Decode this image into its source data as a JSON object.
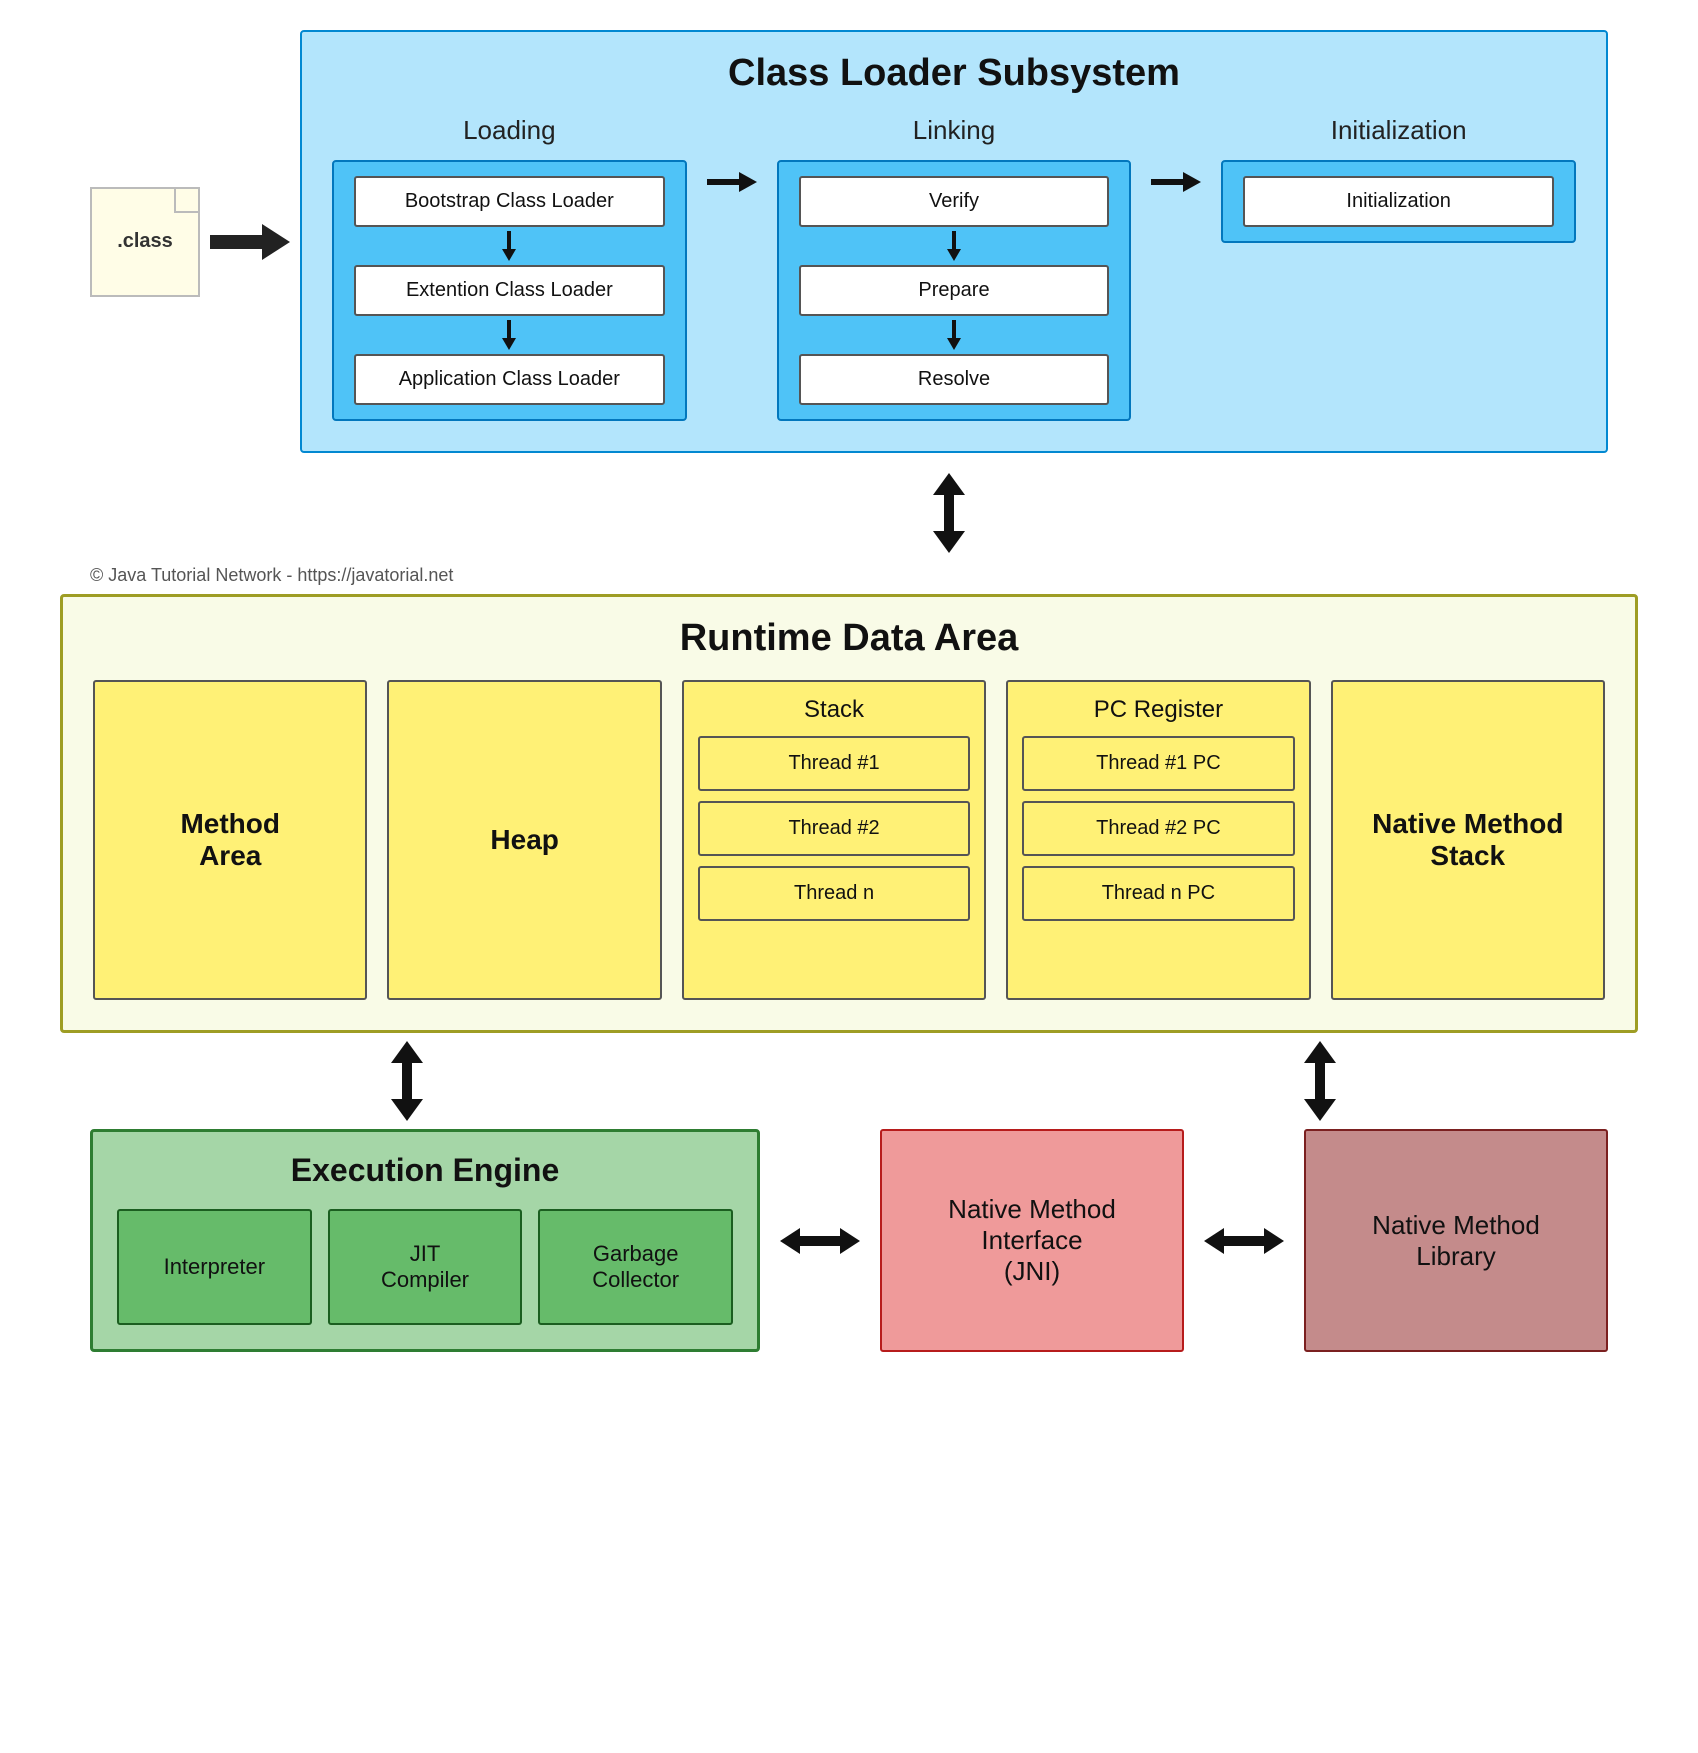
{
  "classFile": {
    "label": ".class"
  },
  "classLoaderSubsystem": {
    "title": "Class Loader Subsystem",
    "phases": {
      "loading": {
        "label": "Loading",
        "items": [
          "Bootstrap Class Loader",
          "Extention Class Loader",
          "Application Class Loader"
        ]
      },
      "linking": {
        "label": "Linking",
        "items": [
          "Verify",
          "Prepare",
          "Resolve"
        ]
      },
      "initialization": {
        "label": "Initialization",
        "items": [
          "Initialization"
        ]
      }
    }
  },
  "copyright": "© Java Tutorial Network - https://javatorial.net",
  "runtimeDataArea": {
    "title": "Runtime Data Area",
    "methodArea": "Method\nArea",
    "heap": "Heap",
    "stack": {
      "title": "Stack",
      "threads": [
        "Thread #1",
        "Thread #2",
        "Thread n"
      ]
    },
    "pcRegister": {
      "title": "PC Register",
      "threads": [
        "Thread #1 PC",
        "Thread #2 PC",
        "Thread n PC"
      ]
    },
    "nativeMethodStack": "Native Method\nStack"
  },
  "executionEngine": {
    "title": "Execution Engine",
    "items": [
      "Interpreter",
      "JIT\nCompiler",
      "Garbage\nCollector"
    ]
  },
  "nativeMethodInterface": {
    "label": "Native Method\nInterface\n(JNI)"
  },
  "nativeMethodLibrary": {
    "label": "Native Method\nLibrary"
  }
}
